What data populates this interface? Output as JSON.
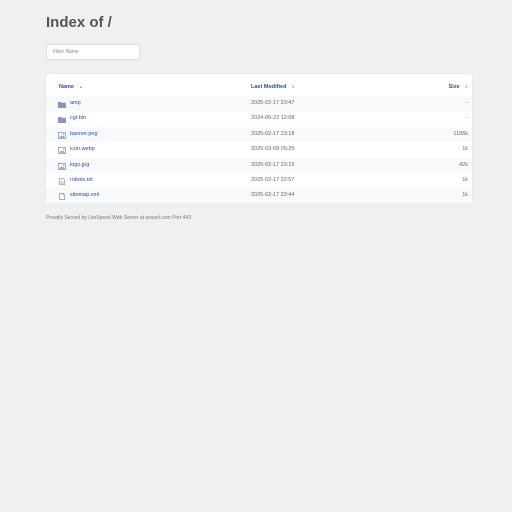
{
  "heading": "Index of /",
  "filter": {
    "placeholder": "Filter Name"
  },
  "table": {
    "columns": {
      "name": "Name",
      "modified": "Last Modified",
      "size": "Size"
    },
    "rows": [
      {
        "icon": "folder-icon",
        "name": "amp",
        "modified": "2025-02-17 23:47",
        "size": "-"
      },
      {
        "icon": "folder-icon",
        "name": "cgi-bin",
        "modified": "2024-06-22 12:08",
        "size": "-"
      },
      {
        "icon": "image-file-icon",
        "name": "banner.png",
        "modified": "2025-02-17 23:18",
        "size": "1186k"
      },
      {
        "icon": "image-file-icon",
        "name": "icon.webp",
        "modified": "2025-03-09 05:25",
        "size": "1k"
      },
      {
        "icon": "image-file-icon",
        "name": "logo.jpg",
        "modified": "2025-02-17 23:15",
        "size": "42k"
      },
      {
        "icon": "text-file-icon",
        "name": "robots.txt",
        "modified": "2025-02-17 22:57",
        "size": "1k"
      },
      {
        "icon": "file-icon",
        "name": "sitemap.xml",
        "modified": "2025-02-17 23:44",
        "size": "1k"
      }
    ]
  },
  "footer": "Proudly Served by LiteSpeed Web Server at wrazel.com Port 443",
  "colors": {
    "link": "#2c4bb0",
    "background": "#eff0f2",
    "icon": "#8b98b5"
  }
}
